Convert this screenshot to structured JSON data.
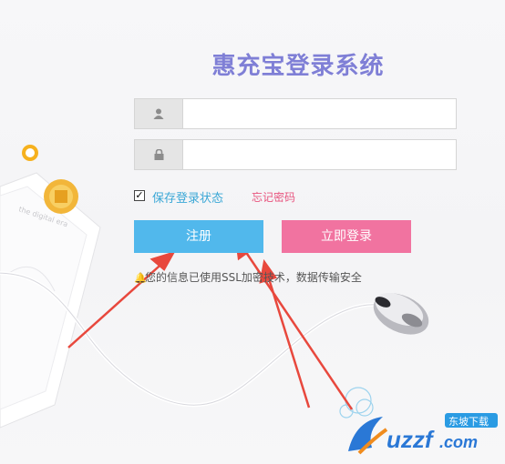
{
  "app": {
    "title": "惠充宝登录系统"
  },
  "form": {
    "username": {
      "value": "",
      "placeholder": "",
      "icon": "user-icon"
    },
    "password": {
      "value": "",
      "placeholder": "",
      "icon": "lock-icon"
    },
    "remember_label": "保存登录状态",
    "remember_checked": true,
    "forgot_label": "忘记密码"
  },
  "buttons": {
    "register_label": "注册",
    "login_label": "立即登录"
  },
  "notice": {
    "text": "您的信息已使用SSL加密技术，数据传输安全"
  },
  "decor": {
    "paper_text": "the digital era",
    "watermark_brand": "uzzf.com",
    "watermark_badge": "东坡下载"
  },
  "colors": {
    "title": "#7f7fd6",
    "register": "#51b8ec",
    "login": "#f173a0",
    "remember": "#3aa7d6",
    "forgot": "#e8557f",
    "arrow": "#e8483d"
  }
}
